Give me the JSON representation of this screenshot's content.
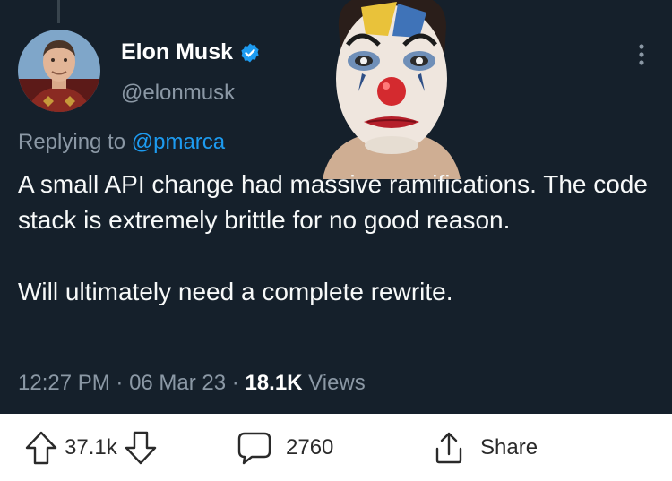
{
  "author": {
    "name": "Elon Musk",
    "handle": "@elonmusk",
    "verified": true
  },
  "reply": {
    "prefix": "Replying to ",
    "mention": "@pmarca"
  },
  "text": "A small API change had massive ramifications. The code stack is extremely brittle for no good reason.\n\nWill ultimately need a complete rewrite.",
  "meta": {
    "time": "12:27 PM",
    "sep1": " · ",
    "date": "06 Mar 23",
    "sep2": " · ",
    "views_count": "18.1K",
    "views_label": " Views"
  },
  "actions": {
    "votes": "37.1k",
    "comments": "2760",
    "share": "Share"
  },
  "colors": {
    "background": "#15202b",
    "accent": "#1d9bf0",
    "secondary_text": "#8b98a5",
    "primary_text": "#f7f9f9"
  },
  "icons": [
    "verified-badge-icon",
    "more-options-icon",
    "upvote-arrow-icon",
    "downvote-arrow-icon",
    "comment-bubble-icon",
    "share-icon"
  ]
}
